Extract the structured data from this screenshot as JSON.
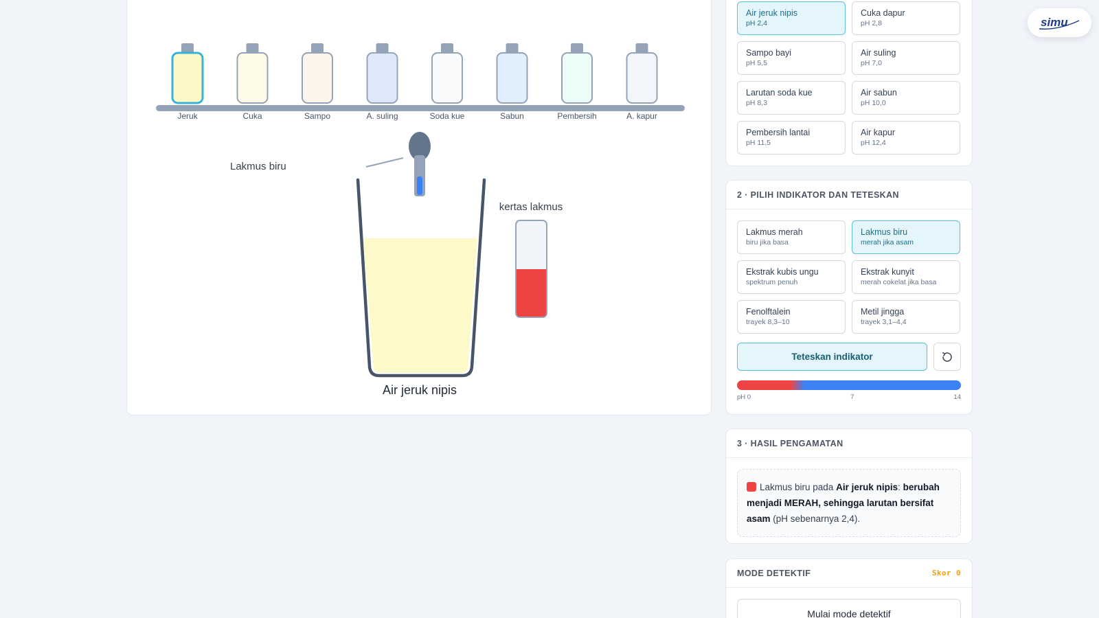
{
  "logo": {
    "text": "simu"
  },
  "simulation": {
    "bottles": [
      {
        "label": "Jeruk",
        "color": "#fef8c7",
        "selected": true
      },
      {
        "label": "Cuka",
        "color": "#fefbe9",
        "selected": false
      },
      {
        "label": "Sampo",
        "color": "#fdf4ec",
        "selected": false
      },
      {
        "label": "A. suling",
        "color": "#dde9fb",
        "selected": false
      },
      {
        "label": "Soda kue",
        "color": "#f8fafc",
        "selected": false
      },
      {
        "label": "Sabun",
        "color": "#e1effd",
        "selected": false
      },
      {
        "label": "Pembersih",
        "color": "#ecfdf9",
        "selected": false
      },
      {
        "label": "A. kapur",
        "color": "#f2f5f9",
        "selected": false
      }
    ],
    "dropper_label": "Lakmus biru",
    "paper_label": "kertas lakmus",
    "beaker_label": "Air jeruk nipis",
    "liquid_color": "#fef9c8",
    "paper_color": "#ef4444"
  },
  "solutions_panel": {
    "items": [
      {
        "name": "Air jeruk nipis",
        "ph": "pH 2,4",
        "active": true
      },
      {
        "name": "Cuka dapur",
        "ph": "pH 2,8",
        "active": false
      },
      {
        "name": "Sampo bayi",
        "ph": "pH 5,5",
        "active": false
      },
      {
        "name": "Air suling",
        "ph": "pH 7,0",
        "active": false
      },
      {
        "name": "Larutan soda kue",
        "ph": "pH 8,3",
        "active": false
      },
      {
        "name": "Air sabun",
        "ph": "pH 10,0",
        "active": false
      },
      {
        "name": "Pembersih lantai",
        "ph": "pH 11,5",
        "active": false
      },
      {
        "name": "Air kapur",
        "ph": "pH 12,4",
        "active": false
      }
    ]
  },
  "indicator_panel": {
    "title": "2 · PILIH INDIKATOR DAN TETESKAN",
    "items": [
      {
        "name": "Lakmus merah",
        "desc": "biru jika basa",
        "active": false
      },
      {
        "name": "Lakmus biru",
        "desc": "merah jika asam",
        "active": true
      },
      {
        "name": "Ekstrak kubis ungu",
        "desc": "spektrum penuh",
        "active": false
      },
      {
        "name": "Ekstrak kunyit",
        "desc": "merah cokelat jika basa",
        "active": false
      },
      {
        "name": "Fenolftalein",
        "desc": "trayek 8,3–10",
        "active": false
      },
      {
        "name": "Metil jingga",
        "desc": "trayek 3,1–4,4",
        "active": false
      }
    ],
    "drip_button": "Teteskan indikator",
    "scale": {
      "min": "pH 0",
      "mid": "7",
      "max": "14"
    }
  },
  "result_panel": {
    "title": "3 · HASIL PENGAMATAN",
    "swatch_color": "#ef4444",
    "text_1": "Lakmus biru pada ",
    "solution": "Air jeruk nipis",
    "text_2": ": ",
    "conclusion": "berubah menjadi MERAH, sehingga larutan bersifat asam",
    "text_3": " (pH sebenarnya 2,4)."
  },
  "detective_panel": {
    "title": "MODE DETEKTIF",
    "score": "Skor 0",
    "button": "Mulai mode detektif"
  }
}
